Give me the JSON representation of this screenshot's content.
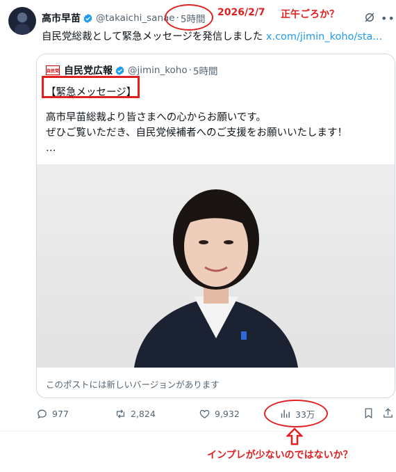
{
  "post": {
    "author_name": "高市早苗",
    "handle": "@takaichi_sanae",
    "separator": "·",
    "time": "5時間",
    "text": "自民党総裁として緊急メッセージを発信しました",
    "link": "x.com/jimin_koho/sta..."
  },
  "quote": {
    "author_name": "自民党広報",
    "logo_text": "自民党",
    "handle": "@jimin_koho",
    "separator": "·",
    "time": "5時間",
    "lines": [
      "【緊急メッセージ】",
      "高市早苗総裁より皆さまへの心からお願いです。",
      "ぜひご覧いただき、自民党候補者へのご支援をお願いいたします！",
      "…"
    ],
    "footer": "このポストには新しいバージョンがあります"
  },
  "actions": {
    "replies": "977",
    "reposts": "2,824",
    "likes": "9,932",
    "views": "33万"
  },
  "annotations": {
    "date": "2026/2/7",
    "noon_question": "正午ごろか？",
    "impression_question": "インプレが少ないのではないか？"
  },
  "colors": {
    "accent": "#1d9bf0",
    "annotation_red": "#e02020",
    "muted_text": "#536471",
    "border": "#cfd9de"
  },
  "icons": [
    "verified-badge-icon",
    "grok-icon",
    "more-icon",
    "reply-icon",
    "repost-icon",
    "like-icon",
    "views-icon",
    "bookmark-icon",
    "share-icon"
  ]
}
